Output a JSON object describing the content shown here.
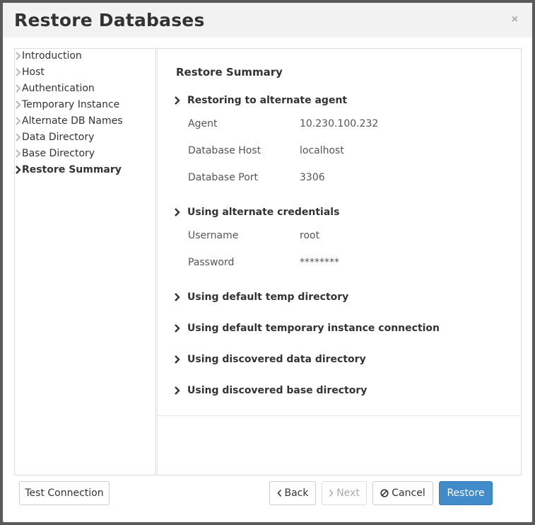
{
  "dialog": {
    "title": "Restore Databases",
    "close_glyph": "×"
  },
  "sidebar": {
    "items": [
      {
        "label": "Introduction",
        "active": false
      },
      {
        "label": "Host",
        "active": false
      },
      {
        "label": "Authentication",
        "active": false
      },
      {
        "label": "Temporary Instance",
        "active": false
      },
      {
        "label": "Alternate DB Names",
        "active": false
      },
      {
        "label": "Data Directory",
        "active": false
      },
      {
        "label": "Base Directory",
        "active": false
      },
      {
        "label": "Restore Summary",
        "active": true
      }
    ]
  },
  "summary": {
    "title": "Restore Summary",
    "sections": [
      {
        "heading": "Restoring to alternate agent",
        "rows": [
          {
            "label": "Agent",
            "value": "10.230.100.232"
          },
          {
            "label": "Database Host",
            "value": "localhost"
          },
          {
            "label": "Database Port",
            "value": "3306"
          }
        ]
      },
      {
        "heading": "Using alternate credentials",
        "rows": [
          {
            "label": "Username",
            "value": "root"
          },
          {
            "label": "Password",
            "value": "********"
          }
        ]
      },
      {
        "heading": "Using default temp directory",
        "rows": []
      },
      {
        "heading": "Using default temporary instance connection",
        "rows": []
      },
      {
        "heading": "Using discovered data directory",
        "rows": []
      },
      {
        "heading": "Using discovered base directory",
        "rows": []
      }
    ]
  },
  "footer": {
    "test_connection_label": "Test Connection",
    "back_label": "Back",
    "next_label": "Next",
    "cancel_label": "Cancel",
    "restore_label": "Restore"
  },
  "colors": {
    "primary": "#428bca",
    "text": "#333333",
    "muted": "#555555"
  }
}
